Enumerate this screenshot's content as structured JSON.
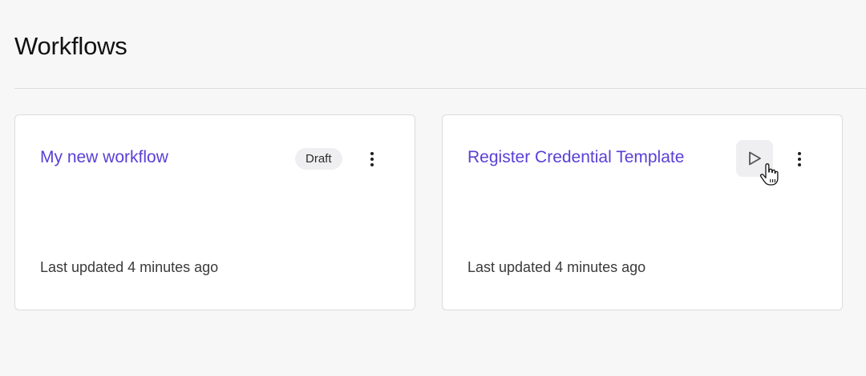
{
  "header": {
    "title": "Workflows"
  },
  "workflows": [
    {
      "title": "My new workflow",
      "status_badge": "Draft",
      "updated": "Last updated 4 minutes ago",
      "more_icon": "more-vertical-icon"
    },
    {
      "title": "Register Credential Template",
      "updated": "Last updated 4 minutes ago",
      "run_icon": "play-icon",
      "more_icon": "more-vertical-icon"
    }
  ],
  "colors": {
    "accent": "#5a3fd6",
    "background": "#f7f7f8",
    "card": "#ffffff",
    "badge_bg": "#efeff1"
  }
}
